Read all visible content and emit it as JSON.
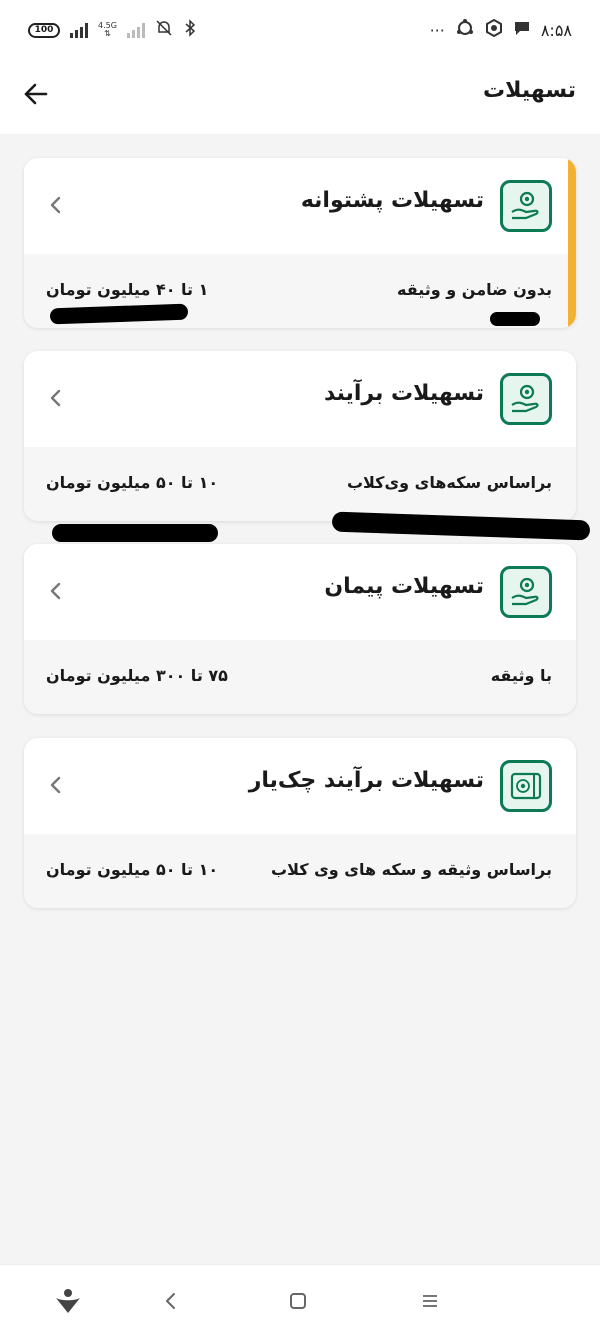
{
  "status_bar": {
    "battery": "100",
    "network": "4.5G",
    "time": "۸:۵۸",
    "dots": "···"
  },
  "header": {
    "title": "تسهیلات"
  },
  "cards": [
    {
      "title": "تسهیلات پشتوانه",
      "description": "بدون ضامن و وثیقه",
      "amount": "۱ تا ۴۰ میلیون تومان",
      "icon": "hand-coin-icon",
      "highlighted": true
    },
    {
      "title": "تسهیلات برآیند",
      "description": "براساس سکه‌های وی‌کلاب",
      "amount": "۱۰ تا ۵۰ میلیون تومان",
      "icon": "hand-coin-icon",
      "highlighted": false
    },
    {
      "title": "تسهیلات پیمان",
      "description": "با وثیقه",
      "amount": "۷۵ تا ۳۰۰ میلیون تومان",
      "icon": "hand-coin-icon",
      "highlighted": false
    },
    {
      "title": "تسهیلات برآیند چک‌یار",
      "description": "براساس وثیقه و سکه های وی کلاب",
      "amount": "۱۰ تا ۵۰ میلیون تومان",
      "icon": "cheque-icon",
      "highlighted": false
    }
  ],
  "colors": {
    "brand_green": "#0b7a55",
    "highlight": "#f2b131"
  }
}
